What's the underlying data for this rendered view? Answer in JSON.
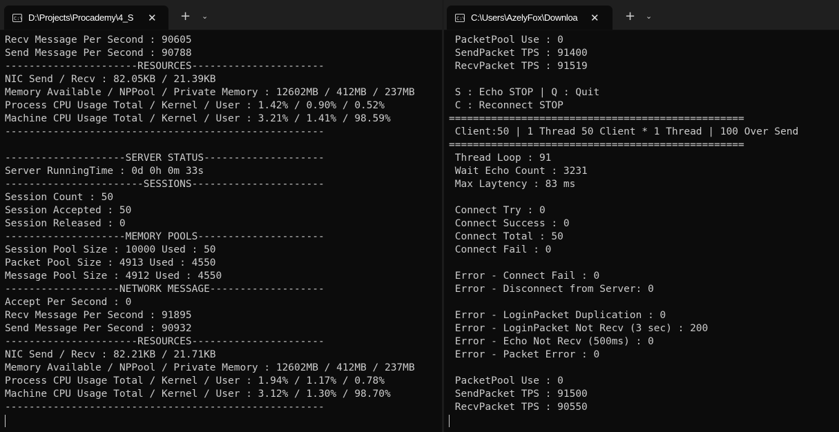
{
  "left_window": {
    "tab_title": "D:\\Projects\\Procademy\\4_S",
    "lines": [
      "Recv Message Per Second : 90605",
      "Send Message Per Second : 90788",
      "----------------------RESOURCES----------------------",
      "NIC Send / Recv : 82.05KB / 21.39KB",
      "Memory Available / NPPool / Private Memory : 12602MB / 412MB / 237MB",
      "Process CPU Usage Total / Kernel / User : 1.42% / 0.90% / 0.52%",
      "Machine CPU Usage Total / Kernel / User : 3.21% / 1.41% / 98.59%",
      "-----------------------------------------------------",
      "",
      "--------------------SERVER STATUS--------------------",
      "Server RunningTime : 0d 0h 0m 33s",
      "-----------------------SESSIONS----------------------",
      "Session Count : 50",
      "Session Accepted : 50",
      "Session Released : 0",
      "--------------------MEMORY POOLS---------------------",
      "Session Pool Size : 10000 Used : 50",
      "Packet Pool Size : 4913 Used : 4550",
      "Message Pool Size : 4912 Used : 4550",
      "-------------------NETWORK MESSAGE-------------------",
      "Accept Per Second : 0",
      "Recv Message Per Second : 91895",
      "Send Message Per Second : 90932",
      "----------------------RESOURCES----------------------",
      "NIC Send / Recv : 82.21KB / 21.71KB",
      "Memory Available / NPPool / Private Memory : 12602MB / 412MB / 237MB",
      "Process CPU Usage Total / Kernel / User : 1.94% / 1.17% / 0.78%",
      "Machine CPU Usage Total / Kernel / User : 3.12% / 1.30% / 98.70%",
      "-----------------------------------------------------"
    ]
  },
  "right_window": {
    "tab_title": "C:\\Users\\AzelyFox\\Downloa",
    "lines": [
      " PacketPool Use : 0",
      " SendPacket TPS : 91400",
      " RecvPacket TPS : 91519",
      "",
      " S : Echo STOP | Q : Quit",
      " C : Reconnect STOP",
      "=================================================",
      " Client:50 | 1 Thread 50 Client * 1 Thread | 100 Over Send",
      "=================================================",
      " Thread Loop : 91",
      " Wait Echo Count : 3231",
      " Max Laytency : 83 ms",
      "",
      " Connect Try : 0",
      " Connect Success : 0",
      " Connect Total : 50",
      " Connect Fail : 0",
      "",
      " Error - Connect Fail : 0",
      " Error - Disconnect from Server: 0",
      "",
      " Error - LoginPacket Duplication : 0",
      " Error - LoginPacket Not Recv (3 sec) : 200",
      " Error - Echo Not Recv (500ms) : 0",
      " Error - Packet Error : 0",
      "",
      " PacketPool Use : 0",
      " SendPacket TPS : 91500",
      " RecvPacket TPS : 90550"
    ]
  },
  "icons": {
    "terminal_tab": "terminal-icon",
    "close": "close-icon",
    "new_tab": "plus-icon",
    "dropdown": "chevron-down-icon"
  },
  "glyphs": {
    "terminal": "C:\\",
    "close": "✕",
    "plus": "+",
    "chevron": "⌄"
  },
  "colors": {
    "background": "#0c0c0c",
    "text": "#cccccc",
    "titlebar": "#1f1f1f"
  }
}
